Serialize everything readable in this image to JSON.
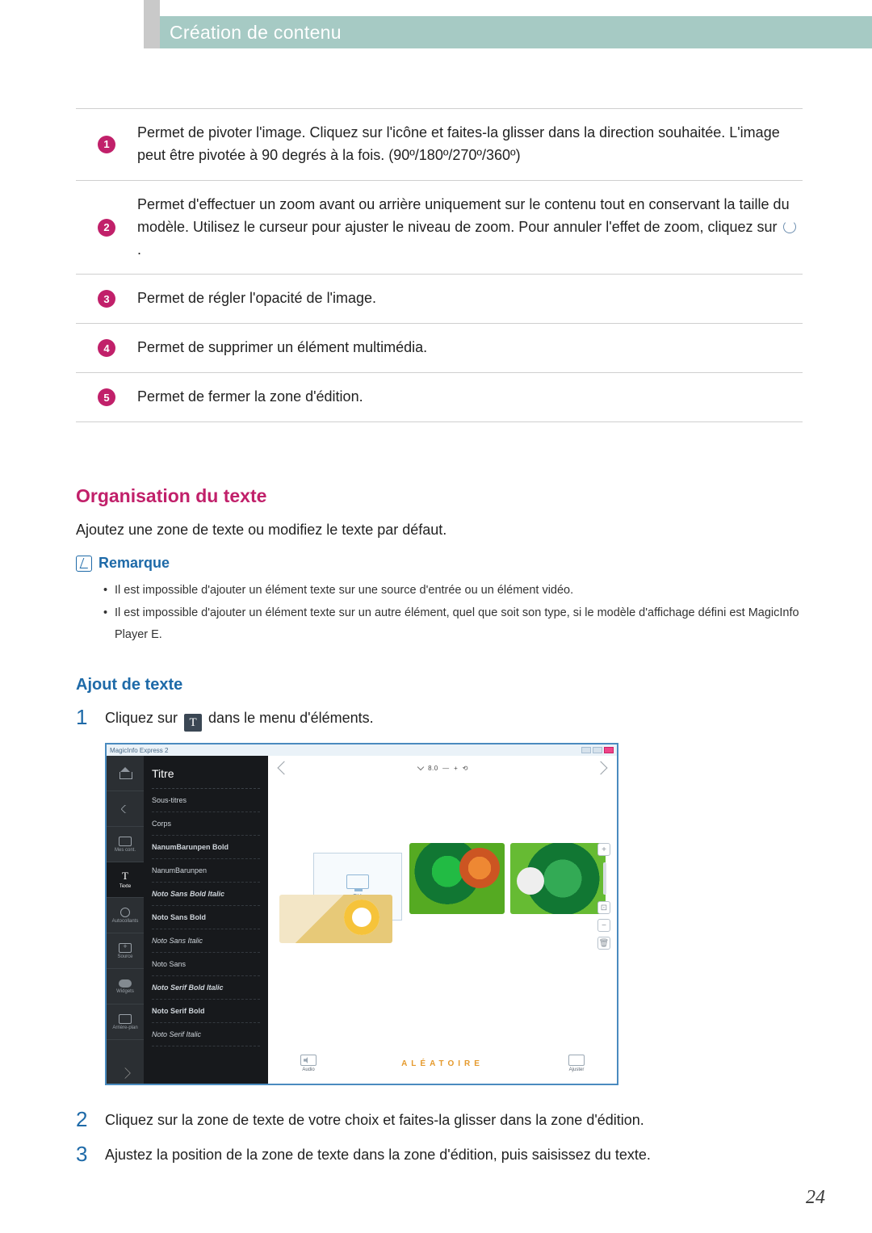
{
  "header": {
    "title": "Création de contenu"
  },
  "table": {
    "rows": [
      {
        "num": "1",
        "desc_pre": "Permet de pivoter l'image. Cliquez sur l'icône et faites-la glisser dans la direction souhaitée. L'image peut être pivotée à 90 degrés à la fois. (90º/180º/270º/360º)",
        "desc_post": "",
        "has_reset": false
      },
      {
        "num": "2",
        "desc_pre": "Permet d'effectuer un zoom avant ou arrière uniquement sur le contenu tout en conservant la taille du modèle. Utilisez le curseur pour ajuster le niveau de zoom. Pour annuler l'effet de zoom, cliquez sur ",
        "desc_post": " .",
        "has_reset": true
      },
      {
        "num": "3",
        "desc_pre": "Permet de régler l'opacité de l'image.",
        "desc_post": "",
        "has_reset": false
      },
      {
        "num": "4",
        "desc_pre": "Permet de supprimer un élément multimédia.",
        "desc_post": "",
        "has_reset": false
      },
      {
        "num": "5",
        "desc_pre": "Permet de fermer la zone d'édition.",
        "desc_post": "",
        "has_reset": false
      }
    ]
  },
  "section1": {
    "heading": "Organisation du texte",
    "intro": "Ajoutez une zone de texte ou modifiez le texte par défaut.",
    "note_title": "Remarque",
    "note_items": [
      "Il est impossible d'ajouter un élément texte sur une source d'entrée ou un élément vidéo.",
      "Il est impossible d'ajouter un élément texte sur un autre élément, quel que soit son type, si le modèle d'affichage défini est MagicInfo Player E."
    ]
  },
  "section2": {
    "heading": "Ajout de texte",
    "steps": {
      "s1_pre": "Cliquez sur ",
      "s1_icon": "T",
      "s1_post": " dans le menu d'éléments.",
      "s2": "Cliquez sur la zone de texte de votre choix et faites-la glisser dans la zone d'édition.",
      "s3": "Ajustez la position de la zone de texte dans la zone d'édition, puis saisissez du texte."
    },
    "nums": {
      "n1": "1",
      "n2": "2",
      "n3": "3"
    }
  },
  "screenshot": {
    "window_title": "MagicInfo Express 2",
    "nav": {
      "home": "",
      "back": "",
      "media": "Mes cont.",
      "text": "Texte",
      "anim": "Autocollants",
      "shapes": "Source",
      "cloud": "Widgets",
      "bg": "Arrière-plan"
    },
    "fontpanel": {
      "title": "Titre",
      "items": [
        {
          "label": "Sous-titres",
          "cls": ""
        },
        {
          "label": "Corps",
          "cls": ""
        },
        {
          "label": "NanumBarunpen Bold",
          "cls": "b"
        },
        {
          "label": "NanumBarunpen",
          "cls": ""
        },
        {
          "label": "Noto Sans Bold Italic",
          "cls": "bi"
        },
        {
          "label": "Noto Sans Bold",
          "cls": "b"
        },
        {
          "label": "Noto Sans Italic",
          "cls": "i"
        },
        {
          "label": "Noto Sans",
          "cls": ""
        },
        {
          "label": "Noto Serif Bold Italic",
          "cls": "bi"
        },
        {
          "label": "Noto Serif Bold",
          "cls": "b"
        },
        {
          "label": "Noto Serif Italic",
          "cls": "i"
        }
      ]
    },
    "canvas": {
      "top_mid": "8.0",
      "tv_label": "TV",
      "bottom_center": "ALÉATOIRE",
      "audio_label": "Audio",
      "fit_label": "Ajuster"
    }
  },
  "page_number": "24"
}
